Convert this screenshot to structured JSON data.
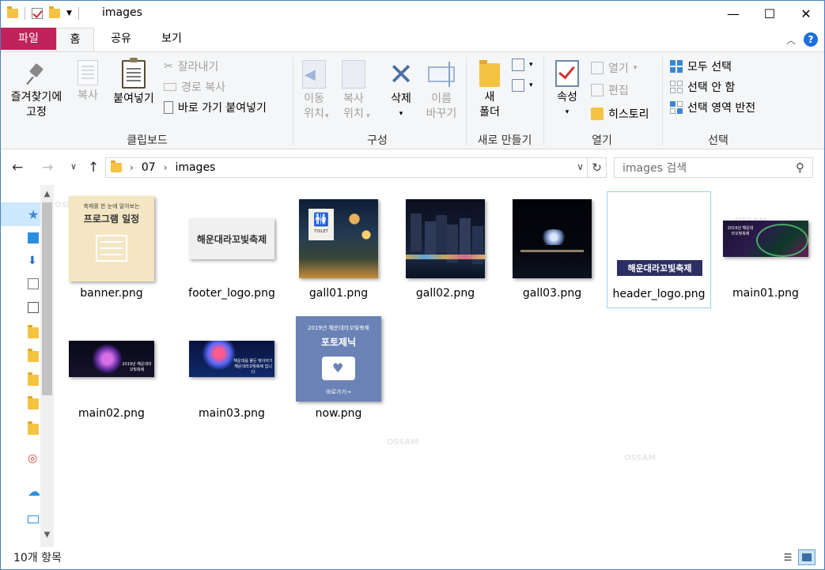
{
  "window": {
    "title": "images",
    "minimize": "—",
    "maximize": "☐",
    "close": "✕"
  },
  "ribbon_tabs": {
    "file": "파일",
    "home": "홈",
    "share": "공유",
    "view": "보기"
  },
  "help": "?",
  "clipboard": {
    "pin_line1": "즐겨찾기에",
    "pin_line2": "고정",
    "copy": "복사",
    "paste": "붙여넣기",
    "cut": "잘라내기",
    "copy_path": "경로 복사",
    "paste_shortcut": "바로 가기 붙여넣기",
    "label": "클립보드"
  },
  "organize": {
    "move_line1": "이동",
    "move_line2": "위치",
    "copyto_line1": "복사",
    "copyto_line2": "위치",
    "delete": "삭제",
    "rename_line1": "이름",
    "rename_line2": "바꾸기",
    "label": "구성"
  },
  "new": {
    "folder_line1": "새",
    "folder_line2": "폴더",
    "label": "새로 만들기"
  },
  "open": {
    "properties": "속성",
    "open": "열기",
    "edit": "편집",
    "history": "히스토리",
    "label": "열기"
  },
  "select": {
    "all": "모두 선택",
    "none": "선택 안 함",
    "invert": "선택 영역 반전",
    "label": "선택"
  },
  "address": {
    "path": [
      "07",
      "images"
    ],
    "search_placeholder": "images 검색"
  },
  "files": [
    {
      "name": "banner.png"
    },
    {
      "name": "footer_logo.png"
    },
    {
      "name": "gall01.png"
    },
    {
      "name": "gall02.png"
    },
    {
      "name": "gall03.png"
    },
    {
      "name": "header_logo.png"
    },
    {
      "name": "main01.png"
    },
    {
      "name": "main02.png"
    },
    {
      "name": "main03.png"
    },
    {
      "name": "now.png"
    }
  ],
  "thumb_text": {
    "banner_small": "축제를 한 눈에 알아보는",
    "banner_big": "프로그램 일정",
    "footer_logo": "해운대라꼬빛축제",
    "gall01_sign": "TOILET",
    "header_logo": "해운대라꼬빛축제",
    "main01_text": "2019년 해운대라꼬빛축제",
    "main02_text": "2019년 해운대라꼬빛축제",
    "main03_text": "해운대를 물든 빛이야기 해운대라꼬빛축제 입니다",
    "now_small": "2019년 해운대라꼬빛축제",
    "now_big": "포토제닉",
    "now_link": "바로가기→"
  },
  "status": {
    "count": "10개 항목"
  },
  "watermark": "OSSAM"
}
